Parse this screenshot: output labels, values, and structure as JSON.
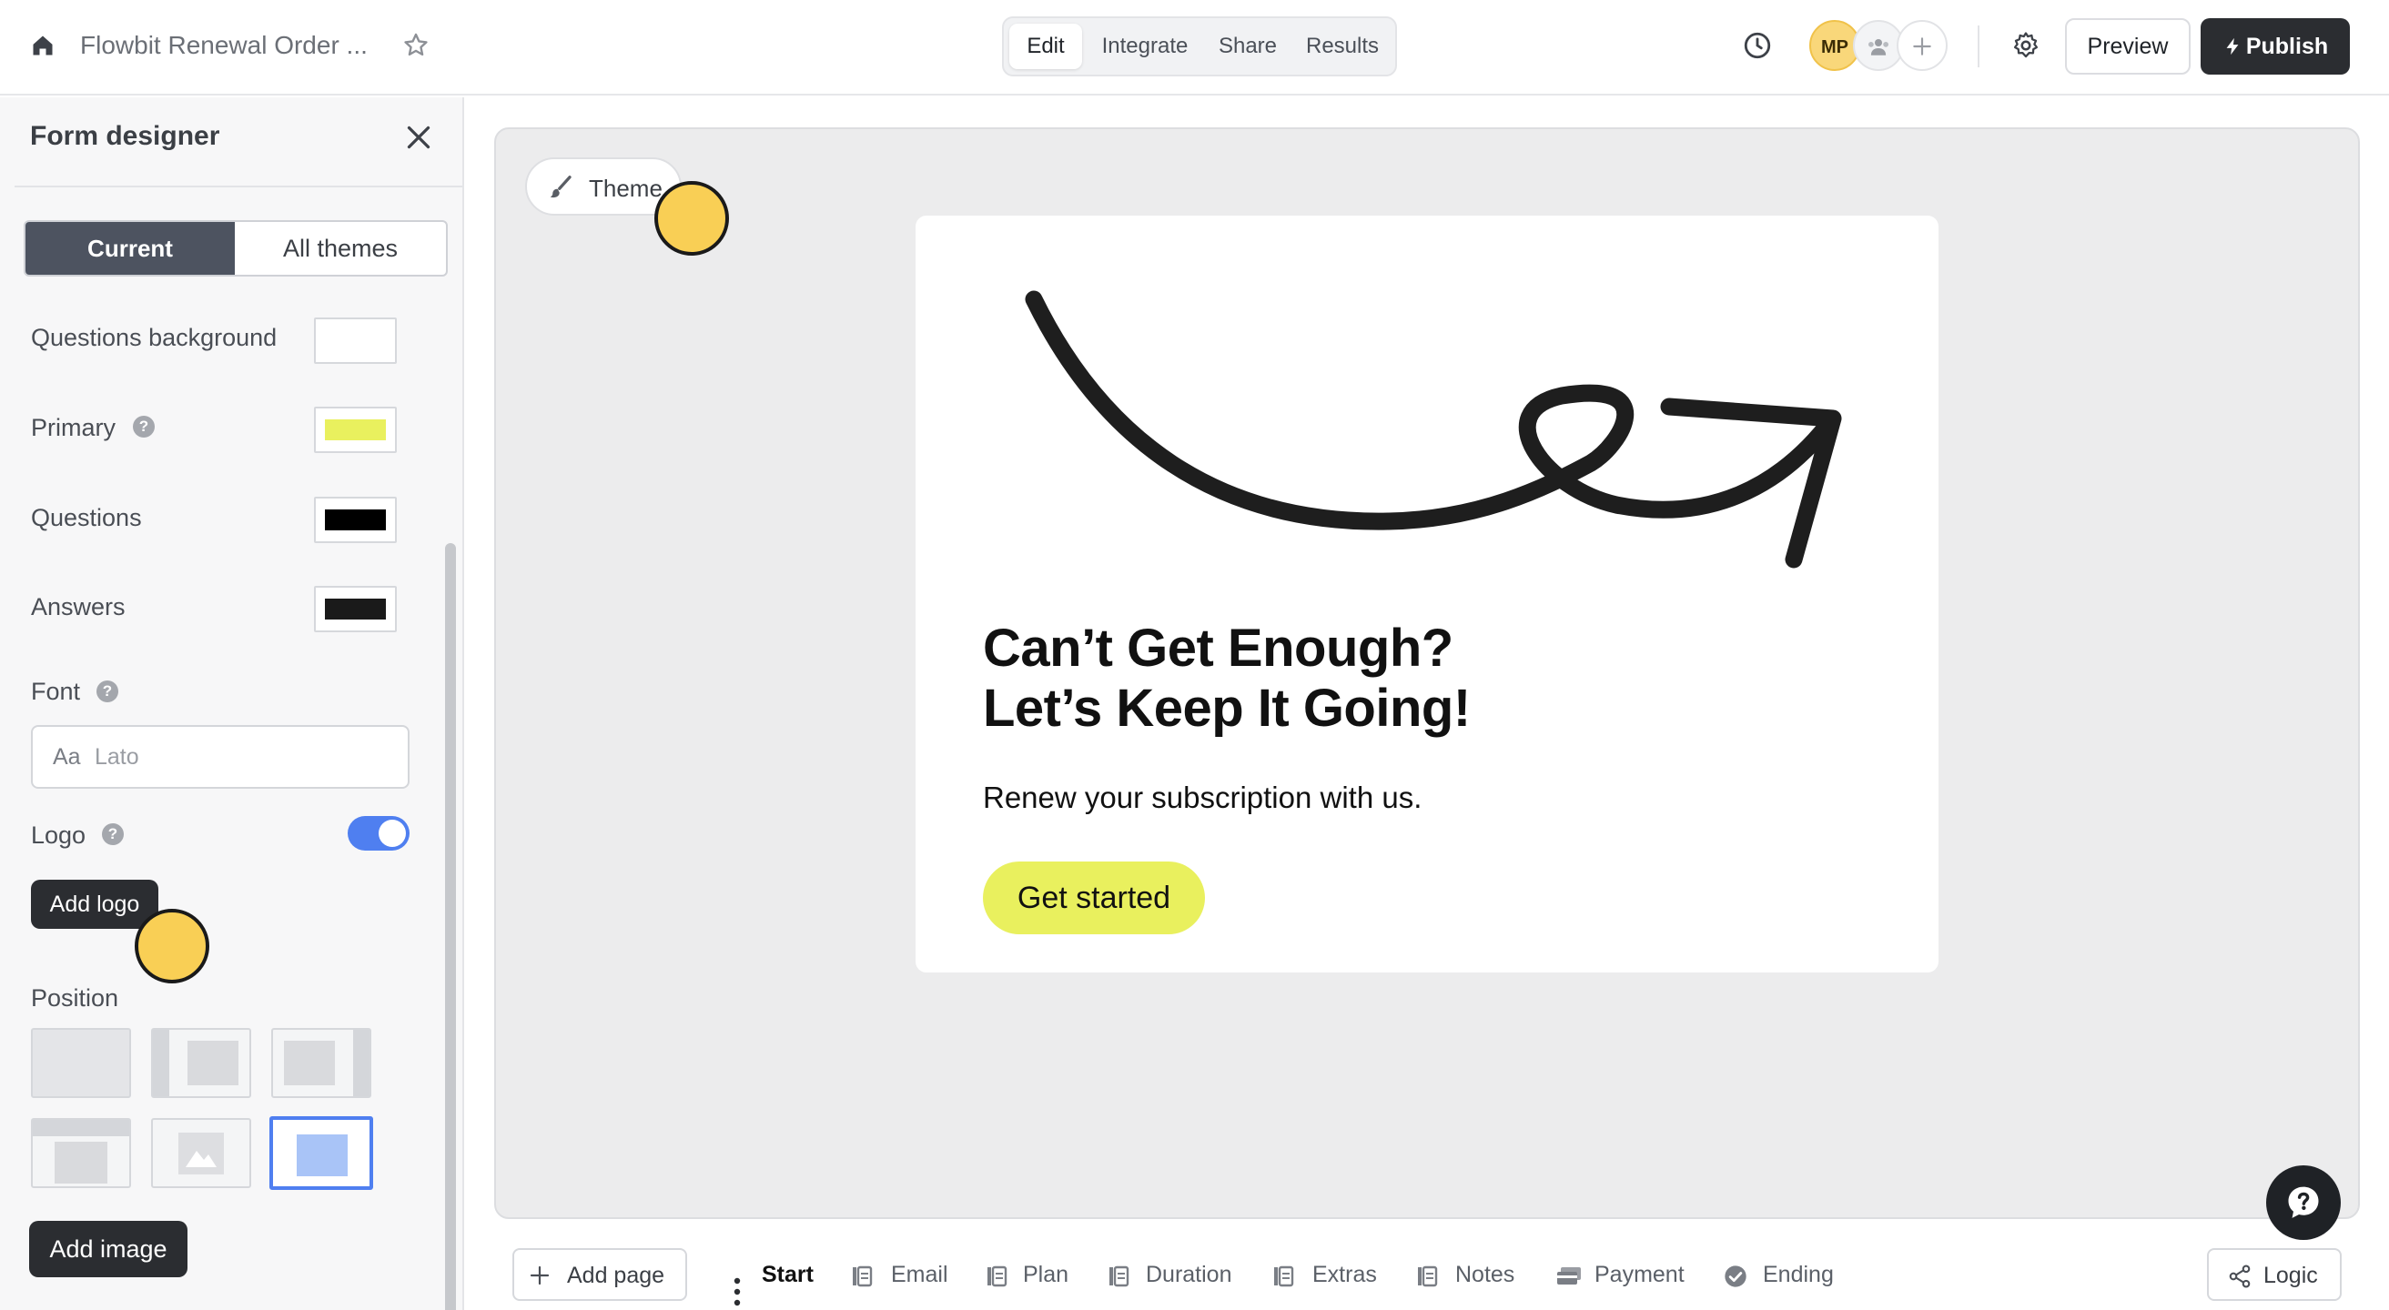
{
  "topbar": {
    "form_title": "Flowbit Renewal Order ...",
    "tabs": [
      {
        "label": "Edit",
        "active": true
      },
      {
        "label": "Integrate",
        "active": false
      },
      {
        "label": "Share",
        "active": false
      },
      {
        "label": "Results",
        "active": false
      }
    ],
    "avatar_initials": "MP",
    "preview_label": "Preview",
    "publish_label": "Publish",
    "icons": [
      "home-icon",
      "star-icon",
      "clock-icon",
      "users-icon",
      "plus-icon",
      "gear-icon",
      "bolt-icon"
    ]
  },
  "sidebar": {
    "title": "Form designer",
    "tabs": {
      "current": "Current",
      "all": "All themes"
    },
    "colors": [
      {
        "label": "Questions background",
        "value": "#ffffff"
      },
      {
        "label": "Primary",
        "value": "#e9f05e",
        "help": true
      },
      {
        "label": "Questions",
        "value": "#000000"
      },
      {
        "label": "Answers",
        "value": "#1a1a1a"
      }
    ],
    "font": {
      "label": "Font",
      "prefix": "Aa",
      "value": "Lato"
    },
    "logo": {
      "label": "Logo",
      "enabled": true,
      "add_label": "Add logo"
    },
    "position": {
      "label": "Position",
      "selected_index": 5
    },
    "add_image_label": "Add image"
  },
  "canvas": {
    "theme_label": "Theme",
    "title_line1": "Can’t Get Enough?",
    "title_line2": "Let’s Keep It Going!",
    "subtitle": "Renew your subscription with us.",
    "cta_label": "Get started",
    "primary_color": "#e9f05e"
  },
  "bottombar": {
    "add_page_label": "Add page",
    "pages": [
      "Start",
      "Email",
      "Plan",
      "Duration",
      "Extras",
      "Notes",
      "Payment",
      "Ending"
    ],
    "active_page": "Start",
    "logic_label": "Logic"
  }
}
